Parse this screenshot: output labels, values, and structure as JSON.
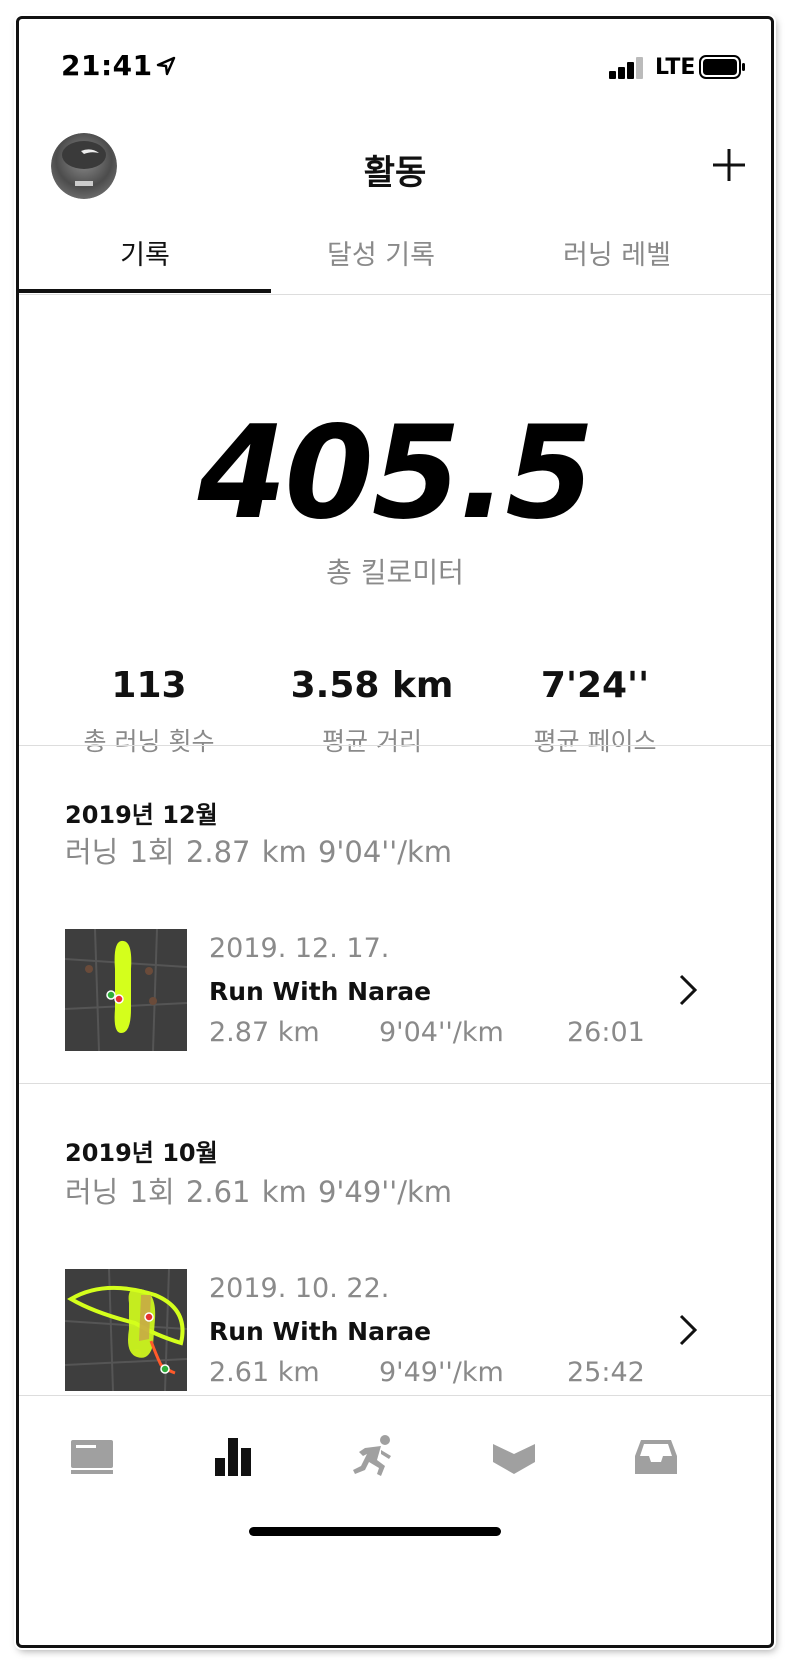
{
  "status_bar": {
    "time": "21:41",
    "carrier": "LTE"
  },
  "header": {
    "title": "활동"
  },
  "tabs": [
    {
      "label": "기록",
      "active": true
    },
    {
      "label": "달성 기록",
      "active": false
    },
    {
      "label": "러닝 레벨",
      "active": false
    }
  ],
  "totals": {
    "total_km": "405.5",
    "total_km_label": "총 킬로미터",
    "stats": [
      {
        "value": "113",
        "label": "총 러닝 횟수"
      },
      {
        "value": "3.58 km",
        "label": "평균 거리"
      },
      {
        "value": "7'24''",
        "label": "평균 페이스"
      }
    ]
  },
  "months": [
    {
      "title": "2019년 12월",
      "summary": "러닝 1회   2.87 km   9'04''/km",
      "runs": [
        {
          "date": "2019. 12. 17.",
          "name": "Run With Narae",
          "distance": "2.87 km",
          "pace": "9'04''/km",
          "duration": "26:01"
        }
      ]
    },
    {
      "title": "2019년 10월",
      "summary": "러닝 1회   2.61 km   9'49''/km",
      "runs": [
        {
          "date": "2019. 10. 22.",
          "name": "Run With Narae",
          "distance": "2.61 km",
          "pace": "9'49''/km",
          "duration": "25:42"
        }
      ]
    }
  ],
  "tab_bar": {
    "items": [
      "feed-icon",
      "activity-chart-icon",
      "runner-icon",
      "club-icon",
      "inbox-icon"
    ],
    "active_index": 1
  },
  "colors": {
    "accent_track": "#d4ff1c",
    "text_primary": "#111111",
    "text_secondary": "#8a8a8a",
    "icon_inactive": "#a0a0a0",
    "map_bg": "#3e3e3e"
  }
}
